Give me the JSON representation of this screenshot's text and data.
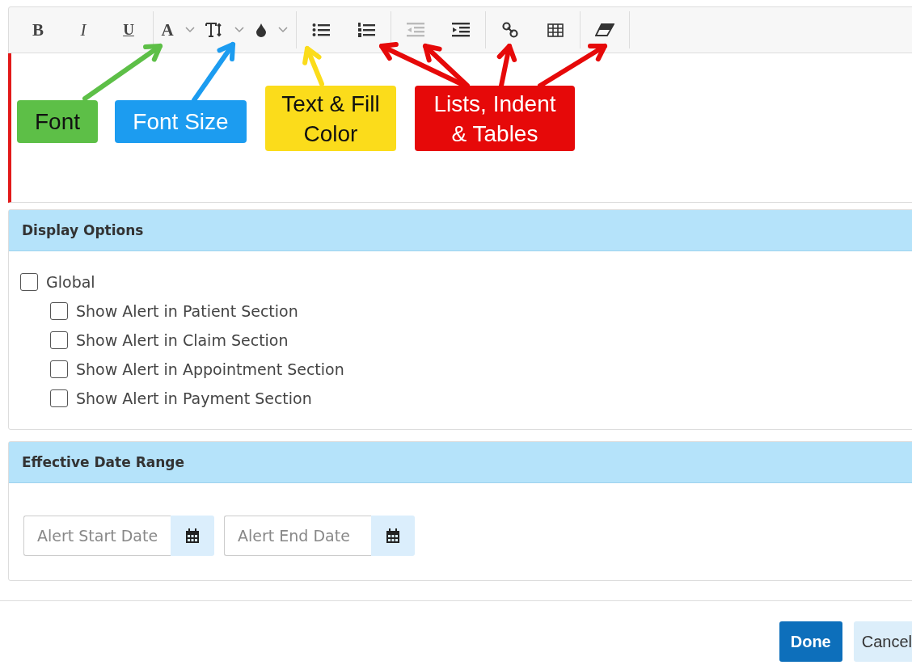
{
  "toolbar": {
    "groups": [
      {
        "items": [
          {
            "kind": "bold",
            "label": "B",
            "dropdown": false,
            "disabled": false
          },
          {
            "kind": "italic",
            "label": "I",
            "dropdown": false,
            "disabled": false
          },
          {
            "kind": "underline",
            "label": "U",
            "dropdown": false,
            "disabled": false
          }
        ]
      },
      {
        "items": [
          {
            "kind": "font",
            "label": "A",
            "dropdown": true,
            "disabled": false
          },
          {
            "kind": "font-size",
            "dropdown": true,
            "disabled": false
          },
          {
            "kind": "color",
            "dropdown": true,
            "disabled": false
          }
        ]
      },
      {
        "items": [
          {
            "kind": "bullet-list",
            "dropdown": false,
            "disabled": false
          },
          {
            "kind": "numbered-list",
            "dropdown": false,
            "disabled": false
          }
        ]
      },
      {
        "items": [
          {
            "kind": "outdent",
            "dropdown": false,
            "disabled": true
          },
          {
            "kind": "indent",
            "dropdown": false,
            "disabled": false
          }
        ]
      },
      {
        "items": [
          {
            "kind": "link",
            "dropdown": false,
            "disabled": false
          },
          {
            "kind": "table",
            "dropdown": false,
            "disabled": false
          }
        ]
      },
      {
        "items": [
          {
            "kind": "eraser",
            "dropdown": false,
            "disabled": false
          }
        ]
      }
    ]
  },
  "annotations": [
    {
      "label": "Font",
      "color": "#5dbf47"
    },
    {
      "label": "Font Size",
      "color": "#1c9cf0"
    },
    {
      "label": "Text & Fill Color",
      "color": "#fbdc1b"
    },
    {
      "label": "Lists, Indent & Tables",
      "color": "#e60909"
    }
  ],
  "display_options": {
    "title": "Display Options",
    "options": [
      {
        "label": "Global",
        "checked": false,
        "children": [
          {
            "label": "Show Alert in Patient Section",
            "checked": false
          },
          {
            "label": "Show Alert in Claim Section",
            "checked": false
          },
          {
            "label": "Show Alert in Appointment Section",
            "checked": false
          },
          {
            "label": "Show Alert in Payment Section",
            "checked": false
          }
        ]
      }
    ]
  },
  "date_range": {
    "title": "Effective Date Range",
    "fields": [
      {
        "placeholder": "Alert Start Date"
      },
      {
        "placeholder": "Alert End Date"
      }
    ]
  },
  "buttons": [
    {
      "label": "Done",
      "kind": "primary"
    },
    {
      "label": "Cancel",
      "kind": "secondary"
    }
  ]
}
